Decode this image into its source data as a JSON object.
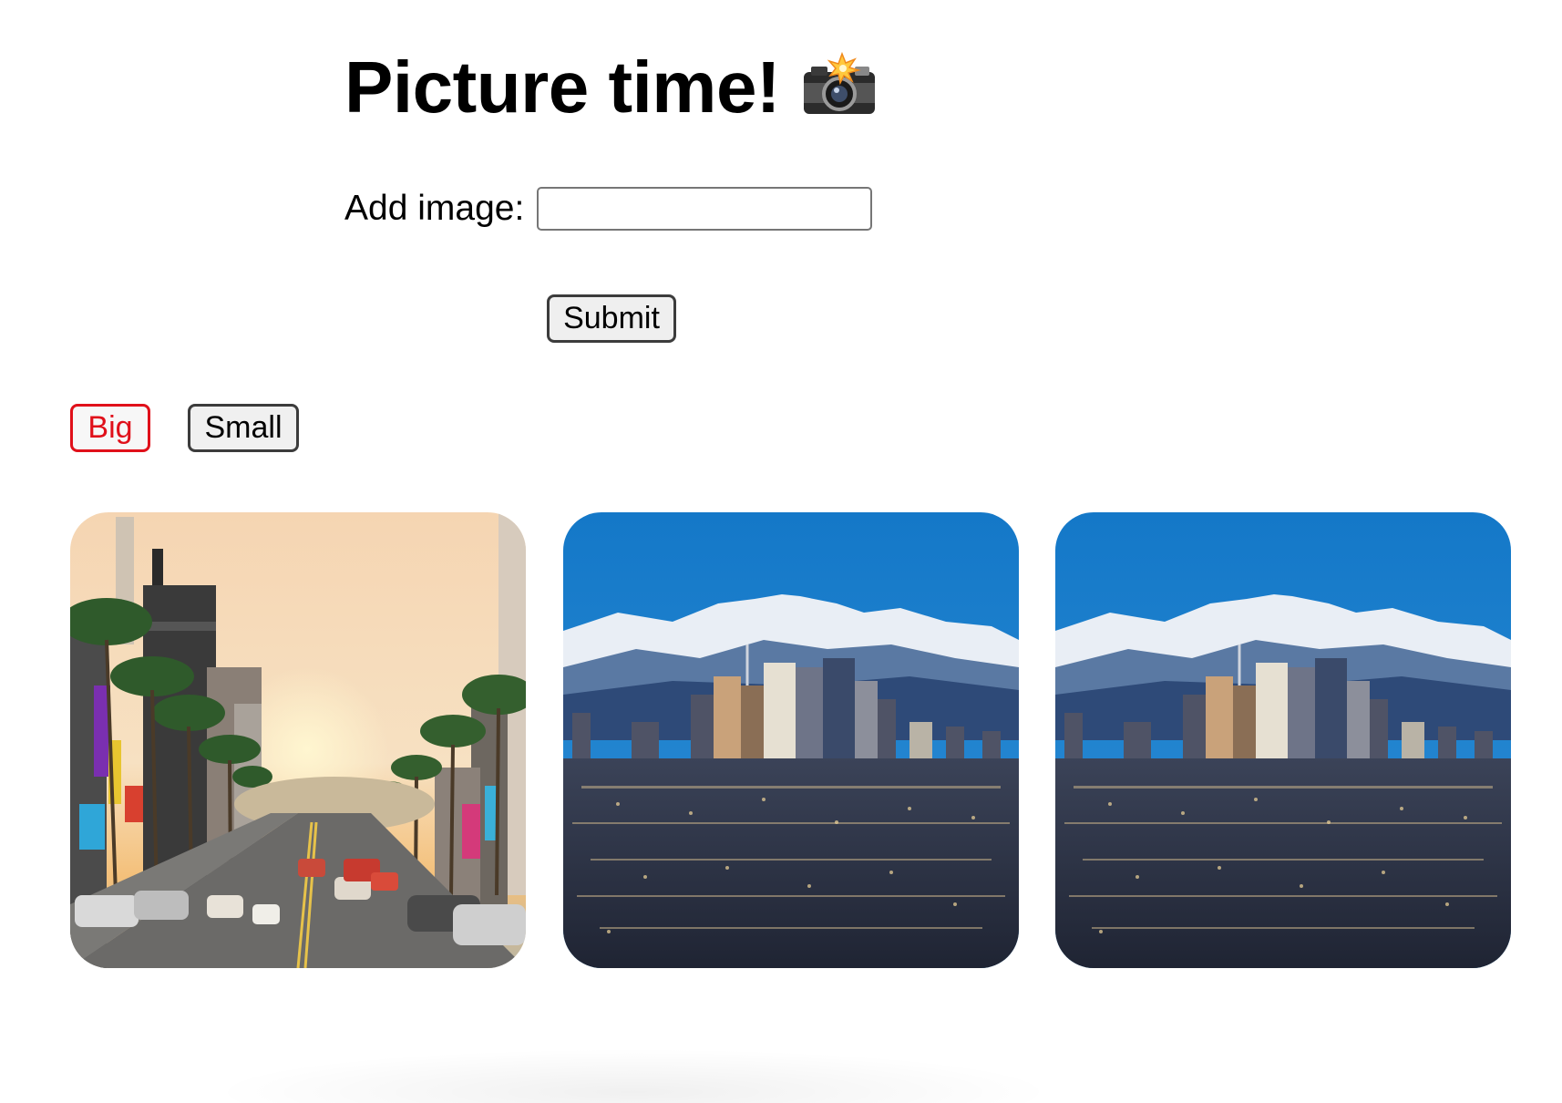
{
  "header": {
    "title": "Picture time!",
    "title_icon": "camera-with-flash-icon"
  },
  "form": {
    "label": "Add image:",
    "input_value": "",
    "input_placeholder": "",
    "submit_label": "Submit"
  },
  "size_toggle": {
    "big_label": "Big",
    "small_label": "Small",
    "selected": "Big",
    "selected_color": "#e0101a"
  },
  "gallery": {
    "images": [
      {
        "subject": "city-street-sunset-photo",
        "palette": [
          "#f6d6ae",
          "#f0b77a",
          "#3b6e3a",
          "#5c5c5c"
        ]
      },
      {
        "subject": "city-skyline-mountains-photo",
        "palette": [
          "#1a7fd0",
          "#f1f4f8",
          "#2a2f45",
          "#c9b59b"
        ]
      },
      {
        "subject": "city-skyline-mountains-photo",
        "palette": [
          "#1a7fd0",
          "#f1f4f8",
          "#2a2f45",
          "#c9b59b"
        ]
      }
    ]
  }
}
